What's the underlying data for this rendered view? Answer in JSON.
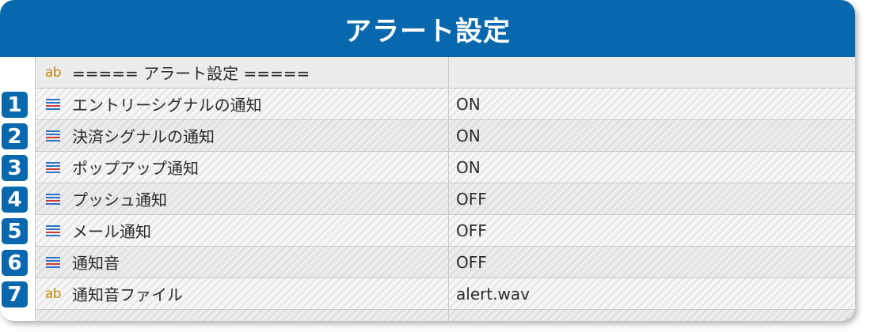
{
  "header": {
    "title": "アラート設定"
  },
  "rows": [
    {
      "number": "",
      "icon": "ab-string-icon",
      "label": "===== アラート設定 =====",
      "value": ""
    },
    {
      "number": "1",
      "icon": "enum-list-icon",
      "label": "エントリーシグナルの通知",
      "value": "ON"
    },
    {
      "number": "2",
      "icon": "enum-list-icon",
      "label": "決済シグナルの通知",
      "value": "ON"
    },
    {
      "number": "3",
      "icon": "enum-list-icon",
      "label": "ポップアップ通知",
      "value": "ON"
    },
    {
      "number": "4",
      "icon": "enum-list-icon",
      "label": "プッシュ通知",
      "value": "OFF"
    },
    {
      "number": "5",
      "icon": "enum-list-icon",
      "label": "メール通知",
      "value": "OFF"
    },
    {
      "number": "6",
      "icon": "enum-list-icon",
      "label": "通知音",
      "value": "OFF"
    },
    {
      "number": "7",
      "icon": "ab-string-icon",
      "label": "通知音ファイル",
      "value": "alert.wav"
    }
  ],
  "icons": {
    "ab_text": "ab"
  },
  "colors": {
    "header_bg": "#0868ae",
    "badge_bg": "#0868ae",
    "ab_icon": "#c8860a"
  }
}
